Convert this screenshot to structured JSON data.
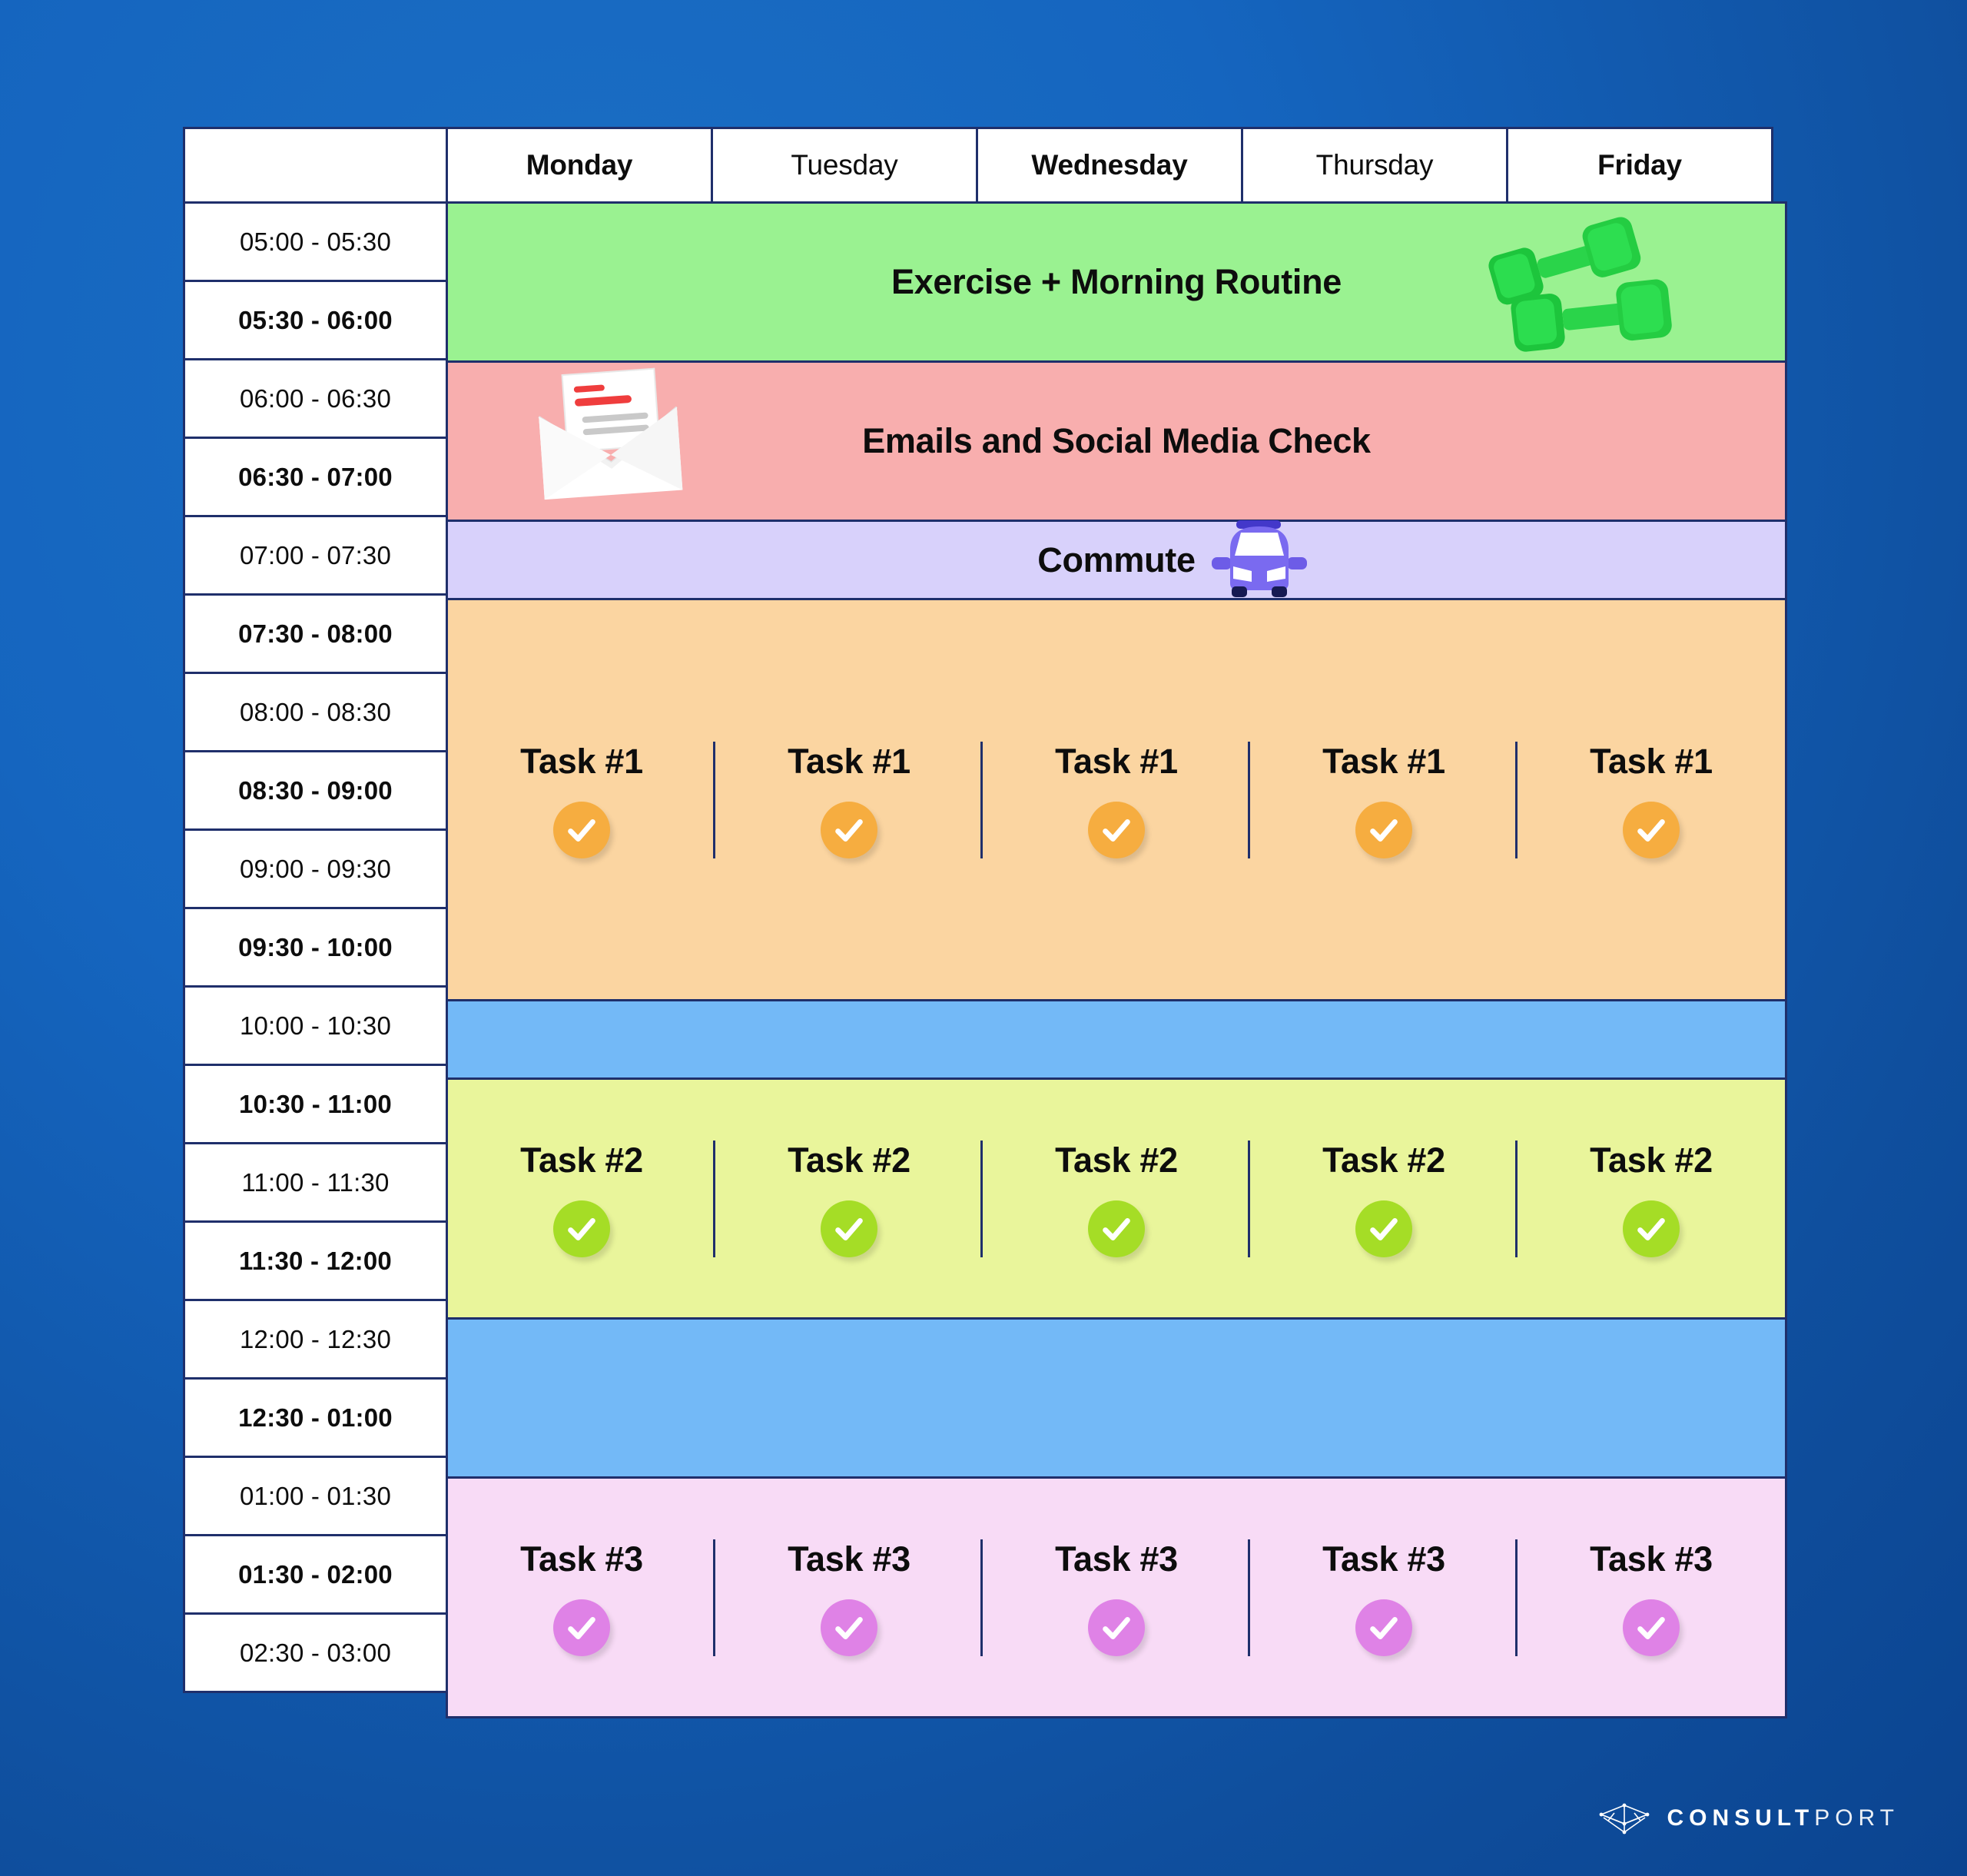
{
  "table": {
    "corner_label": "",
    "days": [
      {
        "label": "Monday",
        "weight": "bold"
      },
      {
        "label": "Tuesday",
        "weight": "reg"
      },
      {
        "label": "Wednesday",
        "weight": "bold"
      },
      {
        "label": "Thursday",
        "weight": "reg"
      },
      {
        "label": "Friday",
        "weight": "bold"
      }
    ],
    "time_slots": [
      {
        "label": "05:00 - 05:30",
        "weight": "reg"
      },
      {
        "label": "05:30 - 06:00",
        "weight": "bold"
      },
      {
        "label": "06:00 - 06:30",
        "weight": "reg"
      },
      {
        "label": "06:30 - 07:00",
        "weight": "bold"
      },
      {
        "label": "07:00 - 07:30",
        "weight": "reg"
      },
      {
        "label": "07:30 - 08:00",
        "weight": "bold"
      },
      {
        "label": "08:00 - 08:30",
        "weight": "reg"
      },
      {
        "label": "08:30 - 09:00",
        "weight": "bold"
      },
      {
        "label": "09:00 - 09:30",
        "weight": "reg"
      },
      {
        "label": "09:30 - 10:00",
        "weight": "bold"
      },
      {
        "label": "10:00 - 10:30",
        "weight": "reg"
      },
      {
        "label": "10:30 - 11:00",
        "weight": "bold"
      },
      {
        "label": "11:00 - 11:30",
        "weight": "reg"
      },
      {
        "label": "11:30 - 12:00",
        "weight": "bold"
      },
      {
        "label": "12:00 - 12:30",
        "weight": "reg"
      },
      {
        "label": "12:30 - 01:00",
        "weight": "bold"
      },
      {
        "label": "01:00 - 01:30",
        "weight": "reg"
      },
      {
        "label": "01:30 - 02:00",
        "weight": "bold"
      },
      {
        "label": "02:30 - 03:00",
        "weight": "reg"
      }
    ]
  },
  "activities": [
    {
      "id": "exercise",
      "label": "Exercise + Morning Routine",
      "rows": 2,
      "color": "#9af291",
      "span": "full",
      "icon": "dumbbell-icon"
    },
    {
      "id": "emails",
      "label": "Emails and Social Media Check",
      "rows": 2,
      "color": "#f8aeae",
      "span": "full",
      "icon": "envelope-icon"
    },
    {
      "id": "commute",
      "label": "Commute",
      "rows": 1,
      "color": "#d8d1fb",
      "span": "full",
      "icon": "car-icon"
    },
    {
      "id": "task1",
      "label": "Task #1",
      "rows": 5,
      "color": "#fbd5a1",
      "span": "per-day",
      "check_color": "#f6ad40"
    },
    {
      "id": "break1",
      "label": "",
      "rows": 1,
      "color": "#73b9f7",
      "span": "full",
      "icon": ""
    },
    {
      "id": "task2",
      "label": "Task #2",
      "rows": 3,
      "color": "#e9f59b",
      "span": "per-day",
      "check_color": "#a5dd26"
    },
    {
      "id": "break2",
      "label": "",
      "rows": 2,
      "color": "#73b9f7",
      "span": "full",
      "icon": ""
    },
    {
      "id": "task3",
      "label": "Task #3",
      "rows": 3,
      "color": "#f8dbf6",
      "span": "per-day",
      "check_color": "#df82e6"
    }
  ],
  "colors": {
    "background": "#1565bf",
    "border": "#1f2f6b",
    "cell_white": "#ffffff",
    "text": "#0d0d0d",
    "logo": "#ffffff"
  },
  "logo": {
    "icon": "paper-boat-icon",
    "word_bold": "CONSULT",
    "word_light": "PORT"
  }
}
